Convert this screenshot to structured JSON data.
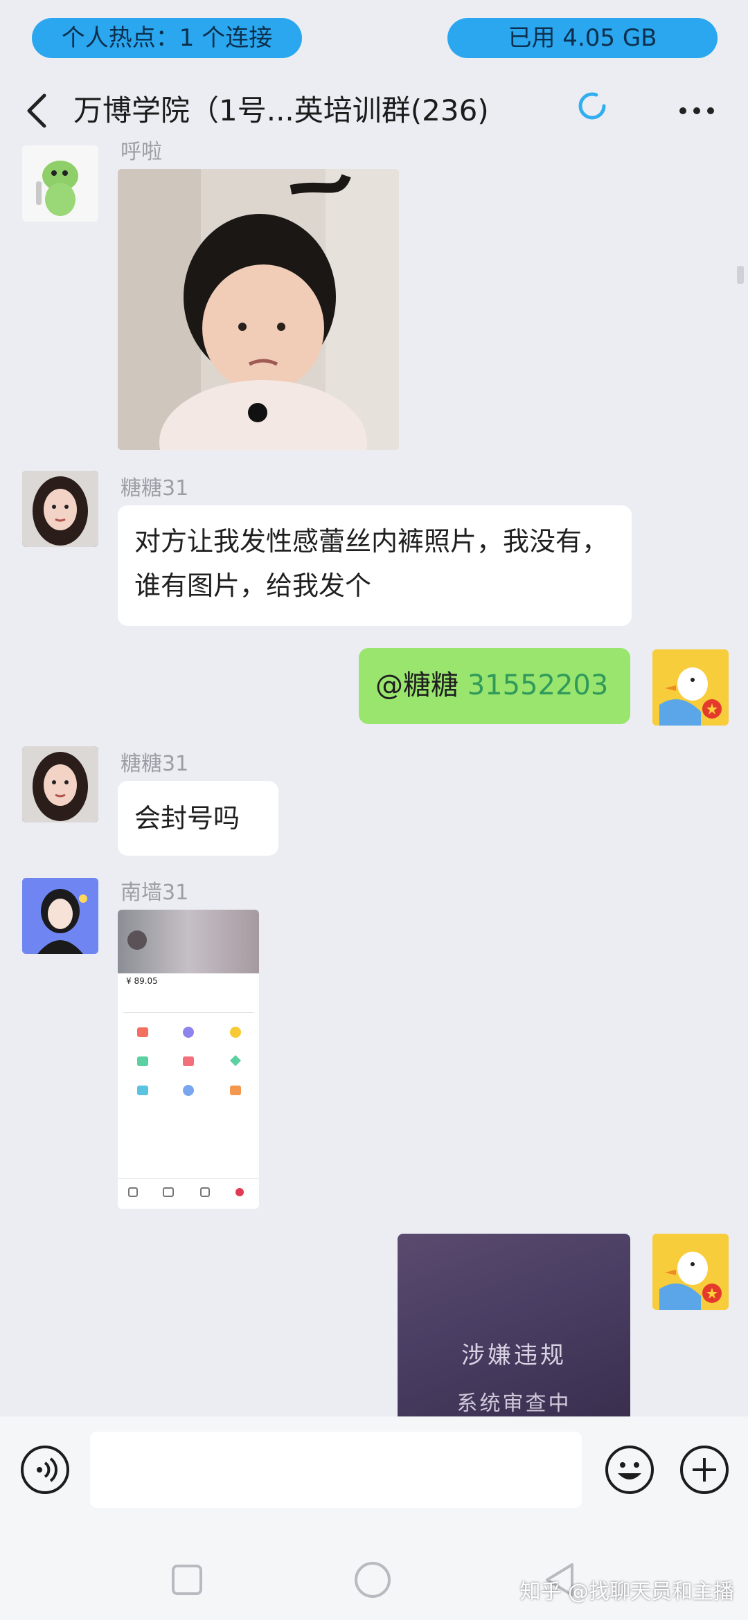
{
  "status_bar": {
    "hotspot_label": "个人热点：1 个连接",
    "storage_label": "已用 4.05 GB"
  },
  "header": {
    "title": "万博学院（1号...英培训群(236)"
  },
  "messages": [
    {
      "sender": "呼啦",
      "type": "image"
    },
    {
      "sender": "糖糖31",
      "text": "对方让我发性感蕾丝内裤照片，我没有，谁有图片，给我发个"
    },
    {
      "sender": "me",
      "mention": "@糖糖",
      "mention_id": "31552203"
    },
    {
      "sender": "糖糖31",
      "text": "会封号吗"
    },
    {
      "sender": "南墙31",
      "type": "screenshot",
      "balance_text": "¥ 89.05"
    },
    {
      "sender": "me",
      "type": "blocked-image",
      "blocked_title": "涉嫌违规",
      "blocked_subtitle": "系统审查中"
    }
  ],
  "icons": {
    "back": "chevron-left-icon",
    "loading": "loading-ring-icon",
    "more": "more-dots-icon",
    "voice": "voice-icon",
    "emoji": "emoji-icon",
    "add": "plus-icon",
    "nav_recent": "square-icon",
    "nav_home": "circle-icon",
    "nav_back": "triangle-icon"
  },
  "watermark": "知乎 @找聊天员和主播",
  "colors": {
    "pill": "#2aa7ef",
    "my_bubble": "#9ae56e",
    "mention_id": "#2f9a5a",
    "background": "#ebedf2"
  }
}
